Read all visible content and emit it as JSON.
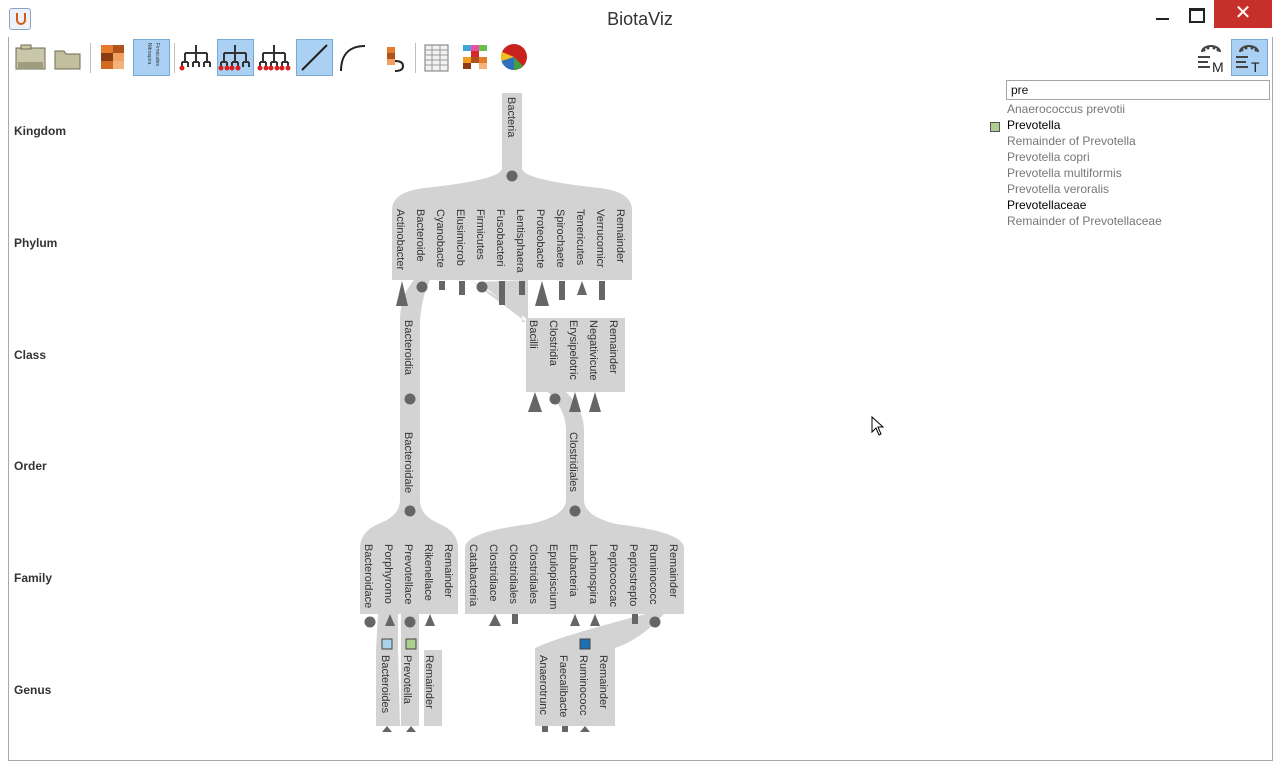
{
  "window": {
    "title": "BiotaViz",
    "close_glyph": "✕"
  },
  "toolbar": {
    "left": [
      {
        "name": "open-file-icon"
      },
      {
        "name": "open-folder-icon"
      },
      {
        "name": "heatmap-icon"
      },
      {
        "name": "names-column-icon",
        "labels": [
          "Nitrospira",
          "Firmicutes"
        ],
        "selected": true
      },
      {
        "name": "tree-leaves-icon"
      },
      {
        "name": "tree-all-nodes-icon",
        "selected": true
      },
      {
        "name": "tree-bottom-nodes-icon"
      },
      {
        "name": "straight-edges-icon",
        "selected": true
      },
      {
        "name": "curved-edges-icon"
      },
      {
        "name": "collapse-icon"
      },
      {
        "name": "table-icon"
      },
      {
        "name": "color-grid-icon"
      },
      {
        "name": "pie-chart-icon"
      }
    ],
    "right": [
      {
        "name": "match-mode-icon",
        "label": "M"
      },
      {
        "name": "taxon-mode-icon",
        "label": "T",
        "selected": true
      }
    ]
  },
  "ranks": [
    "Kingdom",
    "Phylum",
    "Class",
    "Order",
    "Family",
    "Genus"
  ],
  "search": {
    "value": "pre",
    "results": [
      {
        "label": "Anaerococcus prevotii",
        "state": "dim"
      },
      {
        "label": "Prevotella",
        "state": "match",
        "swatch": "#a9d08e"
      },
      {
        "label": "Remainder of Prevotella",
        "state": "dim"
      },
      {
        "label": "Prevotella copri",
        "state": "dim"
      },
      {
        "label": "Prevotella multiformis",
        "state": "dim"
      },
      {
        "label": "Prevotella veroralis",
        "state": "dim"
      },
      {
        "label": "Prevotellaceae",
        "state": "match"
      },
      {
        "label": "Remainder of Prevotellaceae",
        "state": "dim"
      }
    ]
  },
  "tree": {
    "kingdom": [
      "Bacteria"
    ],
    "phylum": [
      "Actinobacter",
      "Bacteroide",
      "Cyanobacte",
      "Elusimicrob",
      "Firmicutes",
      "Fusobacteri",
      "Lentisphaera",
      "Proteobacte",
      "Spirochaete",
      "Tenericutes",
      "Verrucomicr",
      "Remainder"
    ],
    "class_bacteroidetes": [
      "Bacteroidia"
    ],
    "class_firmicutes": [
      "Bacilli",
      "Clostridia",
      "Erysipelotric",
      "Negativicute",
      "Remainder"
    ],
    "order_bacteroidia": [
      "Bacteroidale"
    ],
    "order_clostridia": [
      "Clostridiales"
    ],
    "family_bacteroidales": [
      "Bacteroidace",
      "Porphyromo",
      "Prevotellace",
      "Rikenellace",
      "Remainder"
    ],
    "family_clostridiales": [
      "Catabacteria",
      "Clostridiace",
      "Clostridiales",
      "Clostridiales",
      "Epulopiscium",
      "Eubacteria",
      "Lachnospira",
      "Peptococcac",
      "Peptostrepto",
      "Ruminococc",
      "Remainder"
    ],
    "genus_bacteroidales": [
      {
        "label": "Bacteroides",
        "swatch": "#a8d4ec"
      },
      {
        "label": "Prevotella",
        "swatch": "#a9d08e"
      },
      {
        "label": "Remainder"
      }
    ],
    "genus_ruminococcaceae": [
      {
        "label": "Anaerotrunc"
      },
      {
        "label": "Faecalibacte"
      },
      {
        "label": "Ruminococc",
        "swatch": "#1f6fb4"
      },
      {
        "label": "Remainder"
      }
    ]
  }
}
